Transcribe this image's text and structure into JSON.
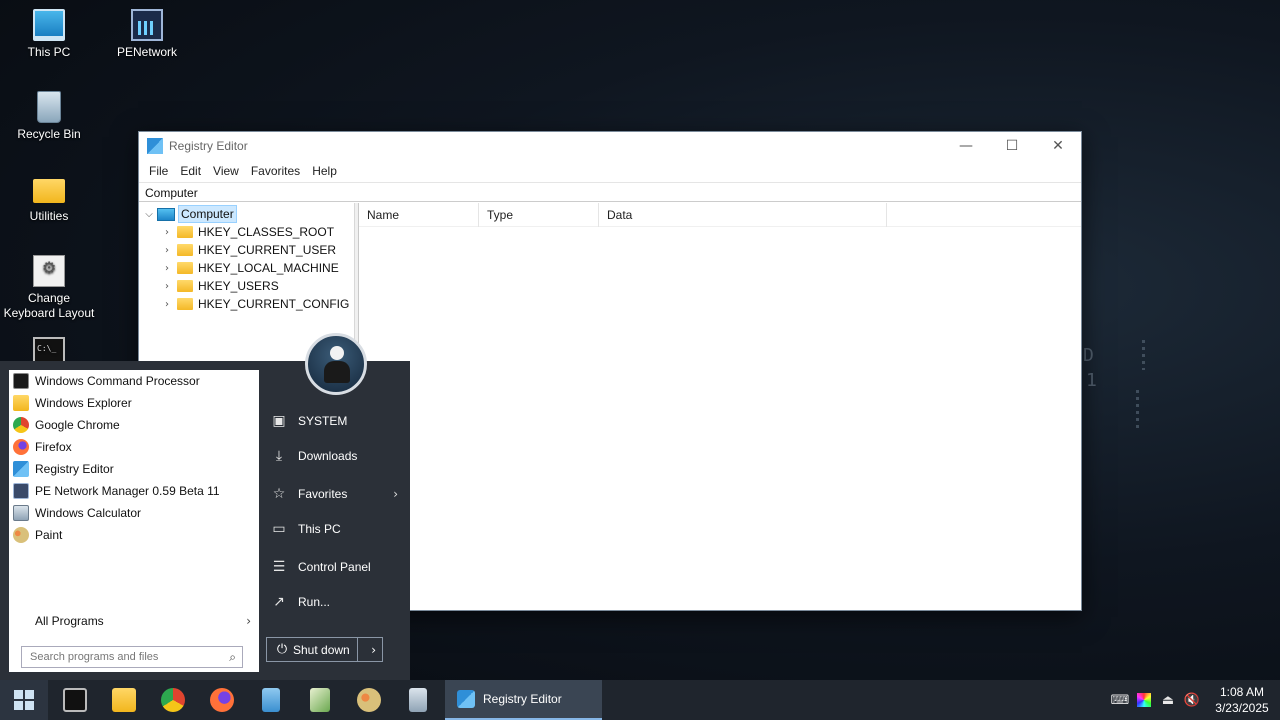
{
  "desktop": {
    "icons": [
      {
        "label": "This PC",
        "icon": "computer-icon"
      },
      {
        "label": "PENetwork",
        "icon": "network-icon"
      },
      {
        "label": "Recycle Bin",
        "icon": "recycle-bin-icon"
      },
      {
        "label": "Utilities",
        "icon": "folder-icon"
      },
      {
        "label": "Change Keyboard Layout",
        "icon": "keyboard-settings-icon"
      },
      {
        "label": "",
        "icon": "cmd-icon"
      }
    ],
    "background_text": [
      "D",
      "1"
    ]
  },
  "registry_editor": {
    "title": "Registry Editor",
    "menu": [
      "File",
      "Edit",
      "View",
      "Favorites",
      "Help"
    ],
    "address": "Computer",
    "tree": {
      "root": "Computer",
      "children": [
        "HKEY_CLASSES_ROOT",
        "HKEY_CURRENT_USER",
        "HKEY_LOCAL_MACHINE",
        "HKEY_USERS",
        "HKEY_CURRENT_CONFIG"
      ]
    },
    "columns": [
      "Name",
      "Type",
      "Data"
    ]
  },
  "start_menu": {
    "programs": [
      {
        "label": "Windows Command Processor",
        "icon": "cmd-icon",
        "color": "#1a1a1a"
      },
      {
        "label": "Windows Explorer",
        "icon": "folder-icon",
        "color": "#f2b61d"
      },
      {
        "label": "Google Chrome",
        "icon": "chrome-icon",
        "color": "#e0452f"
      },
      {
        "label": "Firefox",
        "icon": "firefox-icon",
        "color": "#ff7139"
      },
      {
        "label": "Registry Editor",
        "icon": "regedit-icon",
        "color": "#2f8fd8"
      },
      {
        "label": "PE Network Manager 0.59 Beta 11",
        "icon": "network-icon",
        "color": "#3a4a6a"
      },
      {
        "label": "Windows Calculator",
        "icon": "calculator-icon",
        "color": "#8fa3b5"
      },
      {
        "label": "Paint",
        "icon": "paint-icon",
        "color": "#d9c07a"
      }
    ],
    "all_programs": "All Programs",
    "search_placeholder": "Search programs and files",
    "links": [
      {
        "label": "SYSTEM",
        "icon": "user-folder-icon"
      },
      {
        "label": "Downloads",
        "icon": "download-icon"
      },
      {
        "label": "Favorites",
        "icon": "star-icon"
      },
      {
        "label": "This PC",
        "icon": "computer-icon"
      },
      {
        "label": "Control Panel",
        "icon": "control-panel-icon"
      },
      {
        "label": "Run...",
        "icon": "run-icon"
      }
    ],
    "shutdown": "Shut down"
  },
  "taskbar": {
    "running_app": "Registry Editor",
    "clock_time": "1:08 AM",
    "clock_date": "3/23/2025"
  }
}
